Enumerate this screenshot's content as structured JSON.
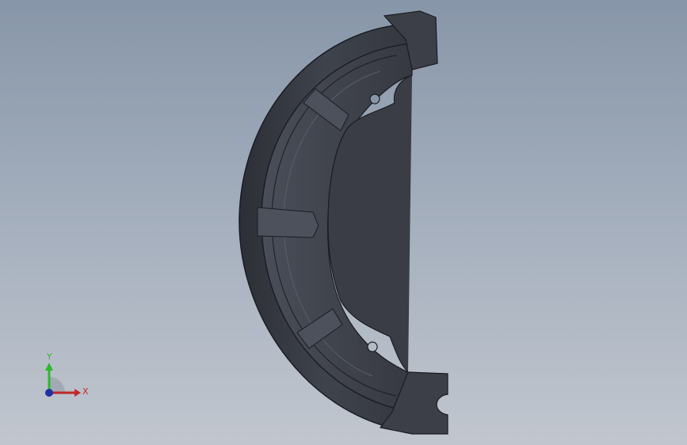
{
  "viewport": {
    "background_top": "#8796a8",
    "background_bottom": "#c1c6ce"
  },
  "model": {
    "part": "brake-shoe",
    "body_color": "#3c3f47",
    "edge_color": "#1a1c21",
    "highlight_color": "#5a5e68"
  },
  "triad": {
    "y_label": "Y",
    "x_label": "X",
    "y_color": "#2eb82e",
    "x_color": "#c0282a",
    "z_color": "#2030a0"
  }
}
